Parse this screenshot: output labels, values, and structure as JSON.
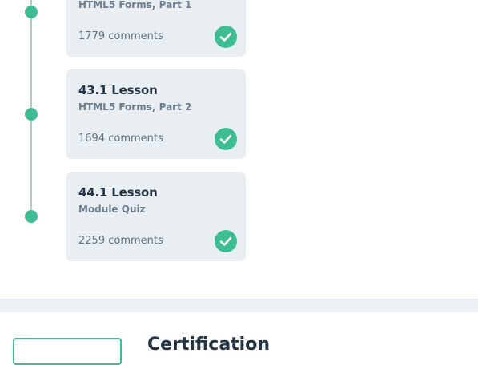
{
  "lessons": [
    {
      "title": "",
      "subtitle": "HTML5 Forms, Part 1",
      "comments": "1779 comments"
    },
    {
      "title": "43.1 Lesson",
      "subtitle": "HTML5 Forms, Part 2",
      "comments": "1694 comments"
    },
    {
      "title": "44.1 Lesson",
      "subtitle": "Module Quiz",
      "comments": "2259 comments"
    }
  ],
  "certification": {
    "heading": "Certification"
  },
  "colors": {
    "accent": "#3ebd93",
    "card_bg": "#e9eef2",
    "timeline": "#b7c7cf"
  }
}
